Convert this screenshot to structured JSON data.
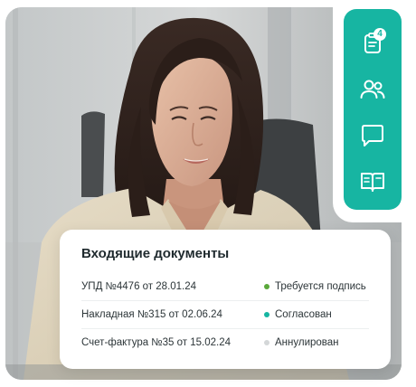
{
  "colors": {
    "accent": "#17b5a2",
    "status_signature": "#5aa83a",
    "status_approved": "#17b5a2",
    "status_cancelled": "#d4d7d8"
  },
  "side_menu": {
    "items": [
      {
        "name": "documents",
        "icon": "document-icon",
        "badge": "4"
      },
      {
        "name": "contacts",
        "icon": "users-icon"
      },
      {
        "name": "messages",
        "icon": "chat-bubble-icon"
      },
      {
        "name": "knowledge",
        "icon": "book-icon"
      }
    ]
  },
  "documents": {
    "title": "Входящие документы",
    "rows": [
      {
        "name": "УПД №4476 от 28.01.24",
        "status": "Требуется подпись",
        "status_color": "#5aa83a"
      },
      {
        "name": "Накладная №315 от 02.06.24",
        "status": "Согласован",
        "status_color": "#17b5a2"
      },
      {
        "name": "Счет-фактура №35 от 15.02.24",
        "status": "Аннулирован",
        "status_color": "#d4d7d8"
      }
    ]
  }
}
